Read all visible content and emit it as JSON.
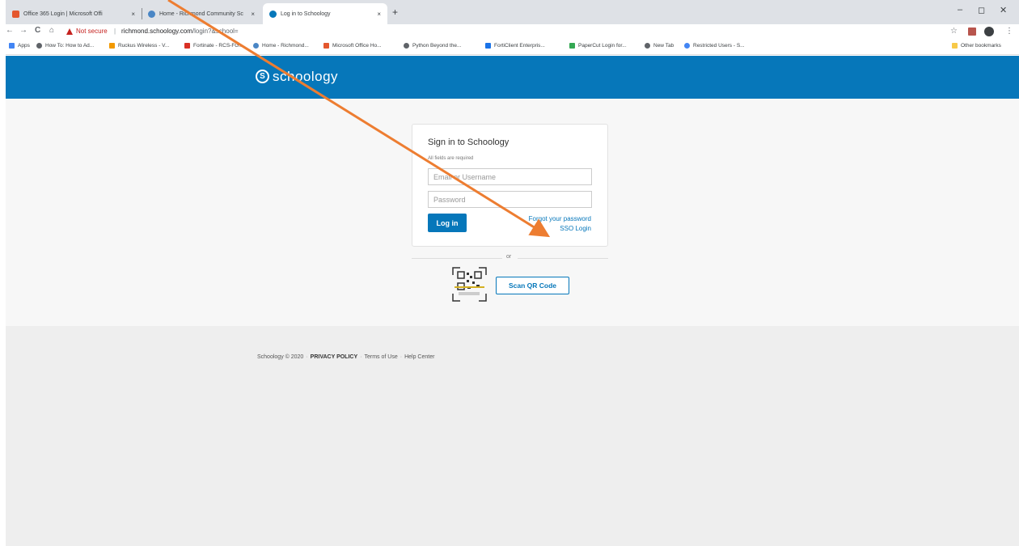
{
  "browser": {
    "tabs": [
      {
        "title": "Office 365 Login | Microsoft Offi",
        "favicon_color": "#e4572e"
      },
      {
        "title": "Home - Richmond Community Sc",
        "favicon_color": "#4a86c5"
      },
      {
        "title": "Log in to Schoology",
        "favicon_color": "#0677ba"
      }
    ],
    "tab_close": "×",
    "new_tab": "+",
    "nav": {
      "back": "←",
      "forward": "→",
      "reload": "C",
      "home": "⌂"
    },
    "security_label": "Not secure",
    "url_separator": "|",
    "url_host": "richmond.schoology.com",
    "url_path": "/login?&school=",
    "window": {
      "minimize": "–",
      "maximize": "◻",
      "close": "✕"
    },
    "star": "☆",
    "menu": "⋮",
    "bookmarks": [
      {
        "label": "Apps",
        "color": "#4285f4"
      },
      {
        "label": "How To: How to Ad...",
        "color": "#5f6368"
      },
      {
        "label": "Ruckus Wireless - V...",
        "color": "#f29900"
      },
      {
        "label": "Fortinate - RCS-FG...",
        "color": "#d93025"
      },
      {
        "label": "Home - Richmond...",
        "color": "#4a86c5"
      },
      {
        "label": "Microsoft Office Ho...",
        "color": "#e4572e"
      },
      {
        "label": "Python Beyond the...",
        "color": "#5f6368"
      },
      {
        "label": "FortiClient Enterpris...",
        "color": "#1a73e8"
      },
      {
        "label": "PaperCut Login for...",
        "color": "#34a853"
      },
      {
        "label": "New Tab",
        "color": "#5f6368"
      },
      {
        "label": "Restricted Users - S...",
        "color": "#4285f4"
      }
    ],
    "other_bookmarks": "Other bookmarks"
  },
  "schoology": {
    "logo_mark": "S",
    "logo_text": "schoology",
    "login": {
      "title": "Sign in to Schoology",
      "required_note": "All fields are required",
      "email_placeholder": "Email or Username",
      "password_placeholder": "Password",
      "login_button": "Log in",
      "forgot_password": "Forgot your password",
      "sso_login": "SSO Login"
    },
    "divider_text": "or",
    "qr_button": "Scan QR Code",
    "footer": {
      "copyright": "Schoology © 2020",
      "privacy": "PRIVACY POLICY",
      "terms": "Terms of Use",
      "help": "Help Center",
      "separator": "·"
    }
  },
  "annotation": {
    "arrow_color": "#ed7d31"
  },
  "colors": {
    "brand": "#0677ba",
    "page_bg": "#f7f7f7",
    "footer_bg": "#eeeeee"
  }
}
